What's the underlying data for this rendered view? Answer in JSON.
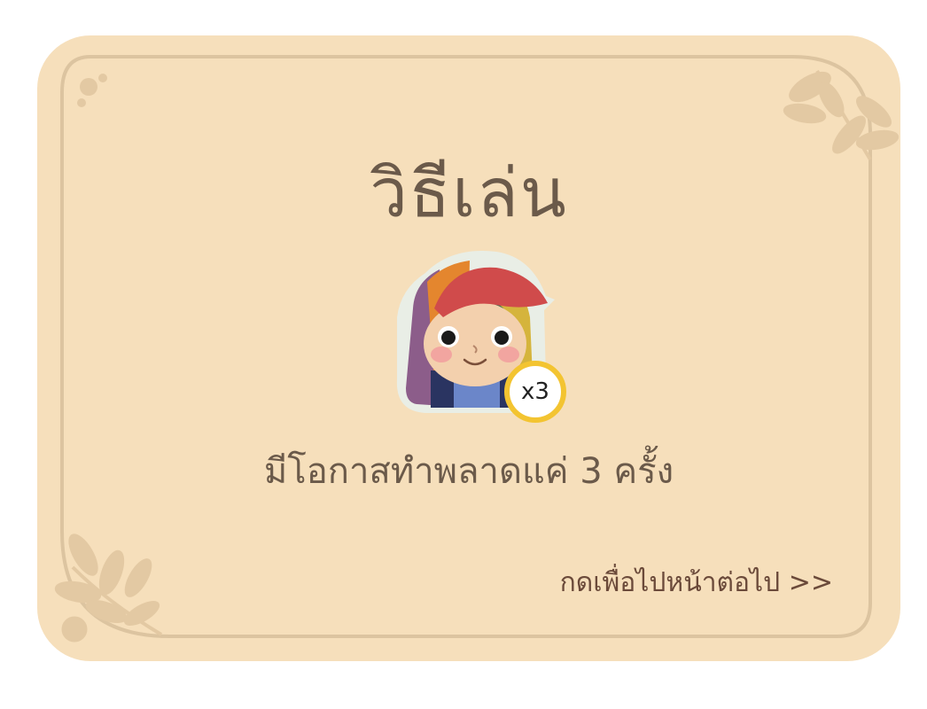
{
  "card": {
    "title": "วิธีเล่น",
    "lives_badge": "x3",
    "instruction": "มีโอกาสทำพลาดแค่ 3 ครั้ง",
    "next_link": "กดเพื่อไปหน้าต่อไป >>"
  },
  "colors": {
    "background": "#f6dfbb",
    "frame_line": "#dcc4a0",
    "text": "#6b5a4a",
    "badge_ring": "#f3c431",
    "leaf": "#e3c9a3"
  },
  "icons": {
    "character": "rainbow-hair-girl-icon",
    "leaves": "leaf-branch-icon",
    "dots": "dots-decoration-icon"
  }
}
